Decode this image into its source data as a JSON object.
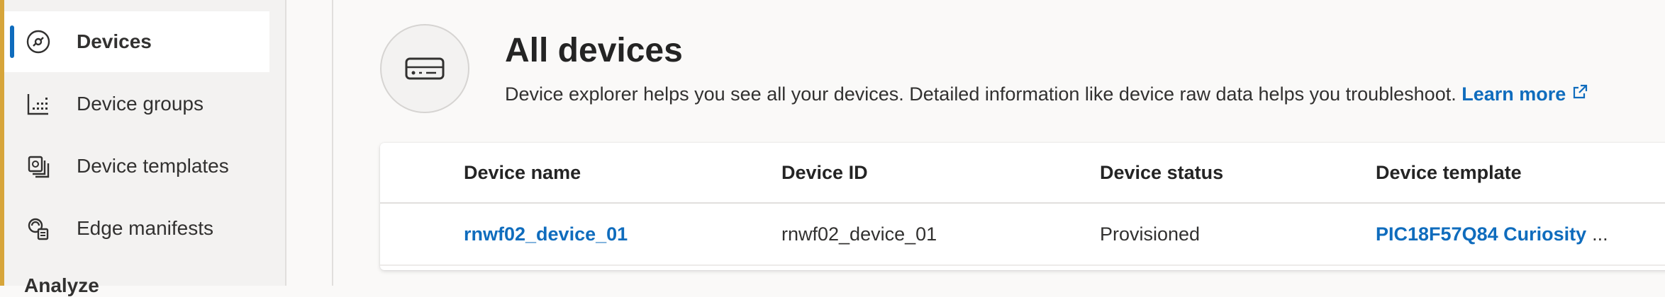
{
  "sidebar": {
    "items": [
      {
        "label": "Devices",
        "icon": "devices-icon",
        "active": true
      },
      {
        "label": "Device groups",
        "icon": "device-groups-icon",
        "active": false
      },
      {
        "label": "Device templates",
        "icon": "device-templates-icon",
        "active": false
      },
      {
        "label": "Edge manifests",
        "icon": "edge-manifests-icon",
        "active": false
      }
    ],
    "next_section_label": "Analyze"
  },
  "header": {
    "title": "All devices",
    "description": "Device explorer helps you see all your devices. Detailed information like device raw data helps you troubleshoot.",
    "learn_more": "Learn more"
  },
  "table": {
    "columns": [
      "Device name",
      "Device ID",
      "Device status",
      "Device template"
    ],
    "rows": [
      {
        "device_name": "rnwf02_device_01",
        "device_id": "rnwf02_device_01",
        "device_status": "Provisioned",
        "device_template": "PIC18F57Q84 Curiosity",
        "template_overflow": "..."
      }
    ]
  },
  "colors": {
    "accent": "#0f6cbd",
    "left_accent": "#d7a53a"
  }
}
